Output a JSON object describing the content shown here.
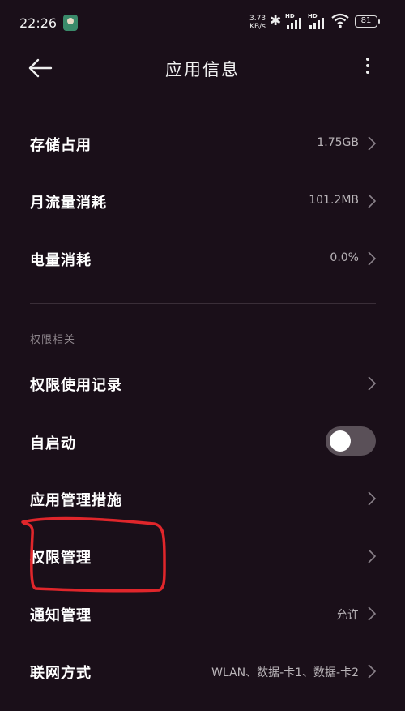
{
  "status_bar": {
    "time": "22:26",
    "net_speed_value": "3.73",
    "net_speed_unit": "KB/s",
    "sim1_label": "HD",
    "sim2_label": "HD",
    "battery": "81"
  },
  "app_bar": {
    "title": "应用信息",
    "back_icon": "arrow-left-icon",
    "more_icon": "more-vertical-icon"
  },
  "rows": {
    "storage": {
      "label": "存储占用",
      "value": "1.75GB"
    },
    "data_usage": {
      "label": "月流量消耗",
      "value": "101.2MB"
    },
    "battery_usage": {
      "label": "电量消耗",
      "value": "0.0%"
    },
    "permission_records": {
      "label": "权限使用记录"
    },
    "autostart": {
      "label": "自启动",
      "enabled": false
    },
    "app_management": {
      "label": "应用管理措施"
    },
    "permission_management": {
      "label": "权限管理"
    },
    "notification_management": {
      "label": "通知管理",
      "value": "允许"
    },
    "network_mode": {
      "label": "联网方式",
      "value": "WLAN、数据-卡1、数据-卡2"
    }
  },
  "section_header": "权限相关",
  "colors": {
    "background": "#1a0f19",
    "annotation": "#e0262b",
    "secondary_text": "#b9b4b8"
  }
}
